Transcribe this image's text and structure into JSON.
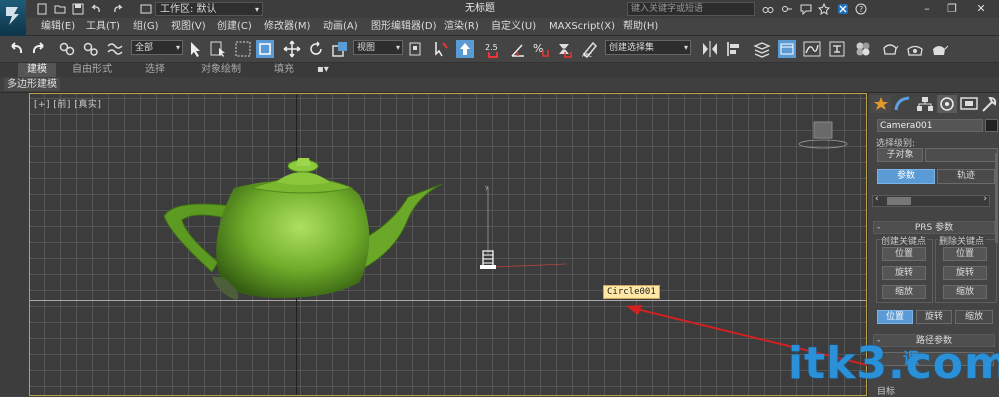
{
  "app": {
    "workspace_label": "工作区: 默认",
    "doc_title": "无标题",
    "search_placeholder": "键入关键字或短语"
  },
  "menu": [
    {
      "label": "编辑(E)"
    },
    {
      "label": "工具(T)"
    },
    {
      "label": "组(G)"
    },
    {
      "label": "视图(V)"
    },
    {
      "label": "创建(C)"
    },
    {
      "label": "修改器(M)"
    },
    {
      "label": "动画(A)"
    },
    {
      "label": "图形编辑器(D)"
    },
    {
      "label": "渲染(R)"
    },
    {
      "label": "自定义(U)"
    },
    {
      "label": "MAXScript(X)"
    },
    {
      "label": "帮助(H)"
    }
  ],
  "toolbar": {
    "selection_filter": "全部",
    "reference_coord": "视图",
    "snap_value": "2.5",
    "named_selection_placeholder": "创建选择集"
  },
  "ribbon": {
    "tabs": [
      "建模",
      "自由形式",
      "选择",
      "对象绘制",
      "填充"
    ],
    "active_tab": "建模",
    "sub_label": "多边形建模"
  },
  "viewport": {
    "label": "[+] [前] [真实]",
    "object_tooltip": "Circle001",
    "teapot_color": "#7cb82f",
    "grid_color": "#555555"
  },
  "command_panel": {
    "object_name": "Camera001",
    "selection_level_label": "选择级别:",
    "sub_object_button": "子对象",
    "mode_buttons": {
      "params": "参数",
      "trajectories": "轨迹"
    },
    "prs_rollout_title": "PRS 参数",
    "create_key_label": "创建关键点",
    "delete_key_label": "删除关键点",
    "create_key_buttons": [
      "位置",
      "旋转",
      "缩放"
    ],
    "delete_key_buttons": [
      "位置",
      "旋转",
      "缩放"
    ],
    "bottom_buttons": [
      "位置",
      "旋转",
      "缩放"
    ],
    "path_rollout_title": "路径参数",
    "partial_label": "目标"
  },
  "watermark": {
    "text": "itk3.com",
    "sub_text": "课"
  },
  "annotation": {
    "arrow_color": "#d42020"
  }
}
